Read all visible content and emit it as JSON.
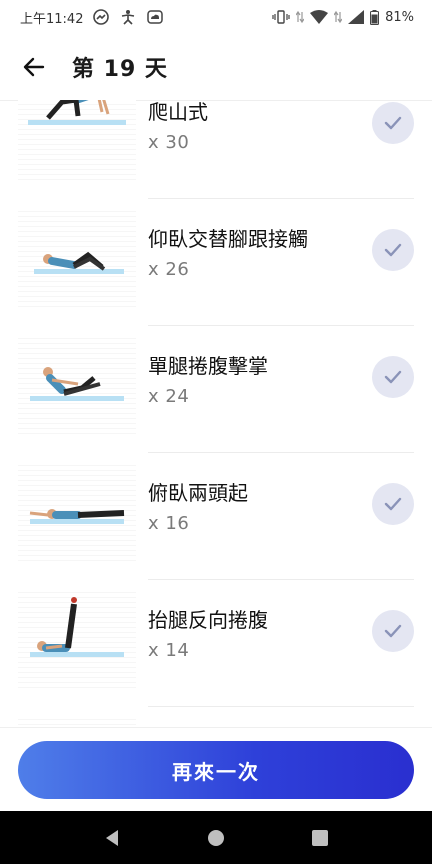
{
  "status_bar": {
    "time": "上午11:42",
    "battery": "81%"
  },
  "header": {
    "title": "第 19 天"
  },
  "exercises": [
    {
      "name": "爬山式",
      "reps": "x 30"
    },
    {
      "name": "仰臥交替腳跟接觸",
      "reps": "x 26"
    },
    {
      "name": "單腿捲腹擊掌",
      "reps": "x 24"
    },
    {
      "name": "俯臥兩頭起",
      "reps": "x 16"
    },
    {
      "name": "抬腿反向捲腹",
      "reps": "x 14"
    }
  ],
  "footer": {
    "button_label": "再來一次"
  },
  "colors": {
    "accent_start": "#4f7ee9",
    "accent_end": "#2a2fd0",
    "check_bg": "#e4e6f2",
    "check_mark": "#8a93b8"
  }
}
